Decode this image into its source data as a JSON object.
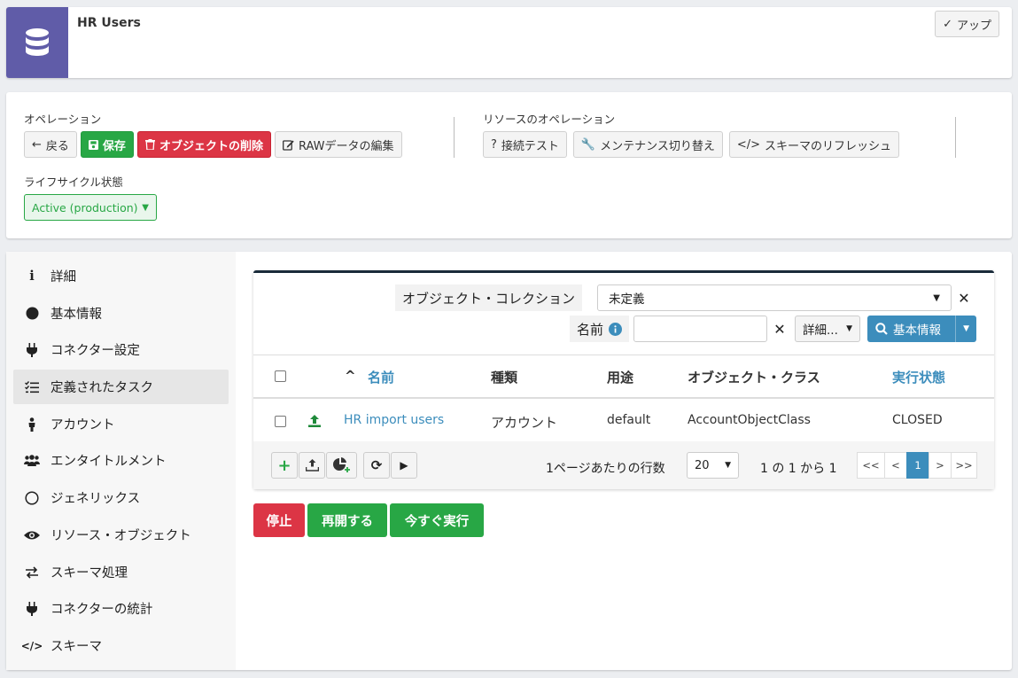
{
  "header": {
    "title": "HR Users",
    "up_label": "アップ"
  },
  "operations": {
    "label": "オペレーション",
    "back": "戻る",
    "save": "保存",
    "delete": "オブジェクトの削除",
    "edit_raw": "RAWデータの編集"
  },
  "resource_operations": {
    "label": "リソースのオペレーション",
    "test_connection": "接続テスト",
    "toggle_maintenance": "メンテナンス切り替え",
    "refresh_schema": "スキーマのリフレッシュ"
  },
  "lifecycle": {
    "label": "ライフサイクル状態",
    "value": "Active (production)"
  },
  "sidebar": {
    "items": [
      {
        "label": "詳細",
        "icon": "info-icon"
      },
      {
        "label": "基本情報",
        "icon": "circle-icon"
      },
      {
        "label": "コネクター設定",
        "icon": "plug-icon"
      },
      {
        "label": "定義されたタスク",
        "icon": "task-list-icon"
      },
      {
        "label": "アカウント",
        "icon": "person-icon"
      },
      {
        "label": "エンタイトルメント",
        "icon": "users-icon"
      },
      {
        "label": "ジェネリックス",
        "icon": "circle-outline-icon"
      },
      {
        "label": "リソース・オブジェクト",
        "icon": "eye-icon"
      },
      {
        "label": "スキーマ処理",
        "icon": "exchange-icon"
      },
      {
        "label": "コネクターの統計",
        "icon": "plug-icon"
      },
      {
        "label": "スキーマ",
        "icon": "code-icon"
      }
    ]
  },
  "filters": {
    "object_collection_label": "オブジェクト・コレクション",
    "object_collection_value": "未定義",
    "name_label": "名前",
    "name_value": "",
    "more_label": "詳細...",
    "basic_search_label": "基本情報"
  },
  "table": {
    "columns": [
      "名前",
      "種類",
      "用途",
      "オブジェクト・クラス",
      "実行状態"
    ],
    "rows": [
      {
        "name": "HR import users",
        "kind": "アカウント",
        "intent": "default",
        "object_class": "AccountObjectClass",
        "status": "CLOSED"
      }
    ]
  },
  "pagination": {
    "rows_per_page_label": "1ページあたりの行数",
    "rows_per_page": "20",
    "range_text": "1 の 1 から 1",
    "first": "<<",
    "prev": "<",
    "page": "1",
    "next": ">",
    "last": ">>"
  },
  "actions": {
    "stop": "停止",
    "resume": "再開する",
    "run_now": "今すぐ実行"
  },
  "colors": {
    "primary": "#3c8dbc",
    "success": "#28a745",
    "danger": "#dc3545",
    "header_icon_bg": "#605ca8"
  }
}
